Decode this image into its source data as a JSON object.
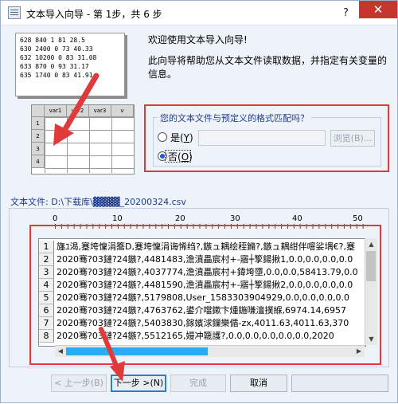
{
  "window": {
    "title": "文本导入向导 - 第 1步，共 6 步",
    "help": "?",
    "close": "✕"
  },
  "illustration": {
    "sample_lines": [
      "628 840 1 81 28.5",
      "630 2400 0 73 40.33",
      "632 10200 0 83 31.08",
      "633 870 0 93 31.17",
      "635 1740 0 83 41.91"
    ],
    "columns": [
      "var1",
      "var2",
      "var3",
      "v"
    ],
    "rows": [
      "1",
      "2",
      "3",
      "4"
    ]
  },
  "intro": {
    "welcome": "欢迎使用文本导入向导!",
    "description": "此向导将帮助您从文本文件读取数据，并指定有关变量的信息。"
  },
  "format_group": {
    "question": "您的文本文件与预定义的格式匹配吗？",
    "yes_label": "是(",
    "yes_key": "Y",
    "no_label": "否(",
    "no_key": "O",
    "selected": "no",
    "browse_label": "浏览(B)..."
  },
  "file": {
    "label": "文本文件: D:\\下载库\\▓▓▓▓_20200324.csv"
  },
  "ruler": {
    "marks": [
      "0",
      "10",
      "20",
      "30",
      "40",
      "50"
    ]
  },
  "preview": {
    "rows": [
      {
        "num": "1",
        "text": "旛ﾕ渴,蹇垮懍涓簥D,蹇垮懍涓诲悕绉?,鏃ュ耦绘秷鏅?,鏃ュ耦绀伴噾娑堣€?,蹇"
      },
      {
        "num": "2",
        "text": "2020骞?03鏈?24鏃?,4481483,澹濆畾宸村+-寤┼箰鍚揪1,0.0,0.0,0.0,0.0"
      },
      {
        "num": "3",
        "text": "2020骞?03鏈?24鏃?,4037774,澹濆畾宸村+鍏垮墮,0.0,0.0,58413.79,0.0"
      },
      {
        "num": "4",
        "text": "2020骞?03鏈?24鏃?,4481590,澹濆畾宸村+-寤┼箰鍚揪2,0.0,0.0,0.0,0.0"
      },
      {
        "num": "5",
        "text": "2020骞?03鏈?24鏃?,5179808,User_1583303904929,0.0,0.0,0.0,0.0"
      },
      {
        "num": "6",
        "text": "2020骞?03鏈?24鏃?,4763762,鍙介噹鏉卞煄鍦嗛澶撲緥,6974.14,6957"
      },
      {
        "num": "7",
        "text": "2020骞?03鏈?24鏃?,5403830,鎵嬪浗鏁樂偱-zx,4011.63,4011.63,370"
      },
      {
        "num": "8",
        "text": "2020骞?03鏈?24鏃?,5512165,嫚冲簚護?,0.0,0.0,0.0,0.0,0.0,2020"
      }
    ]
  },
  "buttons": {
    "back": "< 上一步(B)",
    "next": "下一步 >(N)",
    "finish": "完成",
    "cancel": "取消"
  },
  "colors": {
    "annotation_red": "#e13a3a",
    "scroll_thumb": "#28adf0",
    "close_red": "#c7352c"
  }
}
